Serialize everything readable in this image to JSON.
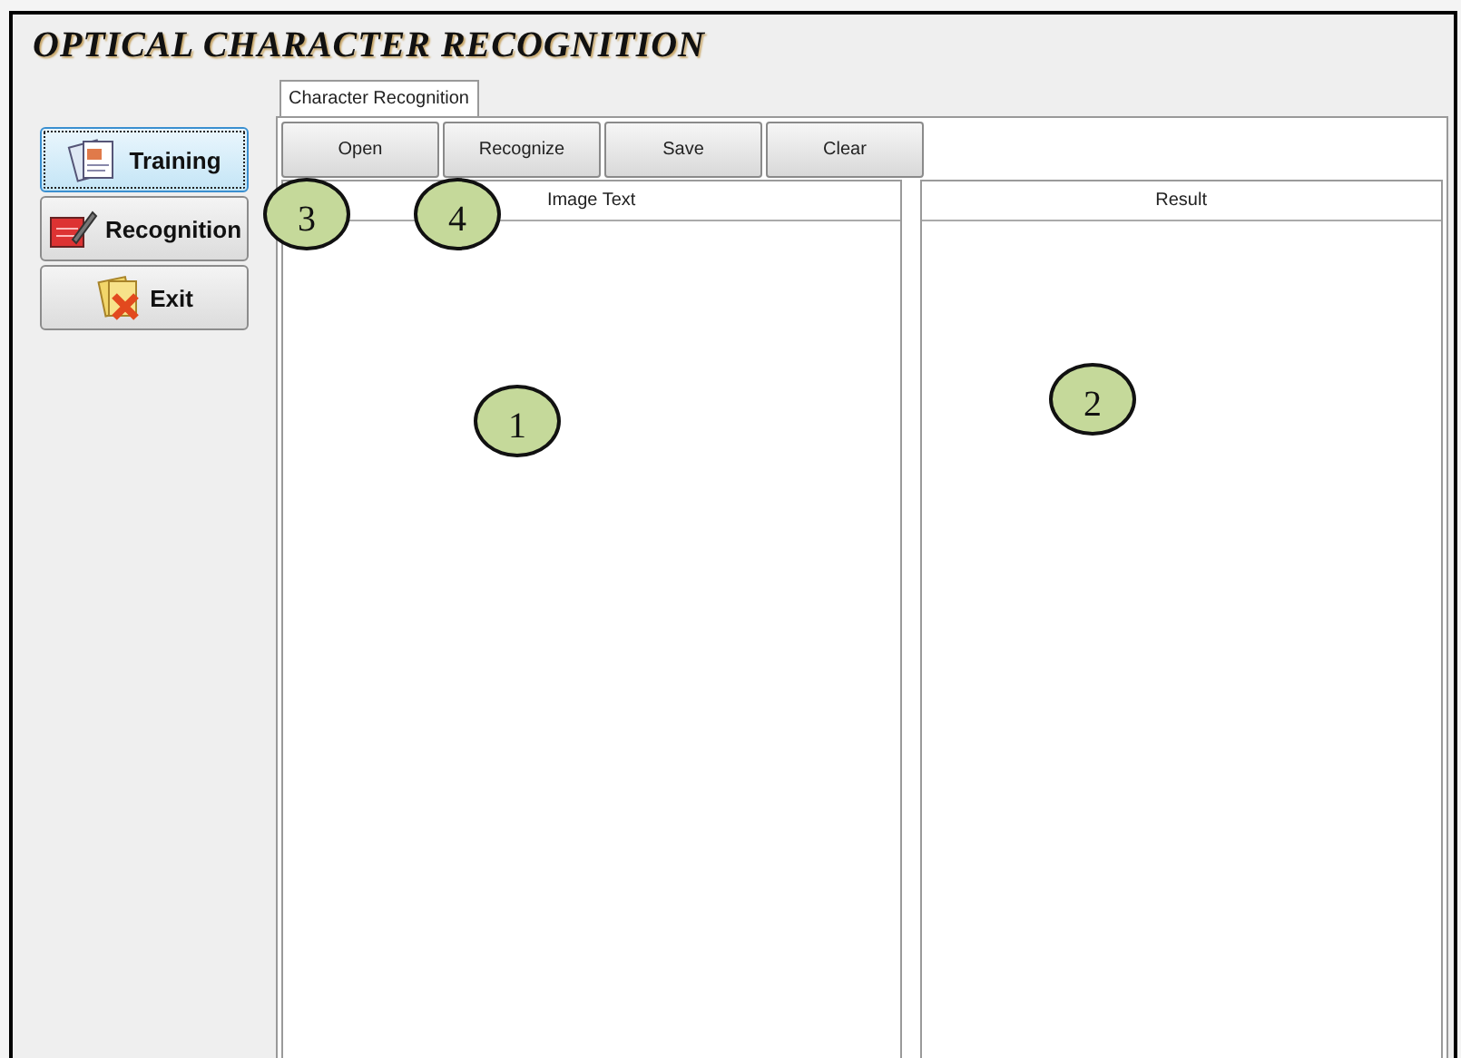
{
  "window": {
    "title": "OPTICAL CHARACTER RECOGNITION"
  },
  "sidebar": {
    "buttons": [
      {
        "label": "Training",
        "kind": "training",
        "selected": true
      },
      {
        "label": "Recognition",
        "kind": "recognition",
        "selected": false
      },
      {
        "label": "Exit",
        "kind": "exit",
        "selected": false
      }
    ]
  },
  "tabs": [
    {
      "label": "Character Recognition",
      "selected": true
    }
  ],
  "toolbar": {
    "buttons": [
      "Open",
      "Recognize",
      "Save",
      "Clear"
    ]
  },
  "panels": [
    {
      "header": "Image Text"
    },
    {
      "header": "Result"
    }
  ],
  "callouts": [
    "1",
    "2",
    "3",
    "4"
  ]
}
